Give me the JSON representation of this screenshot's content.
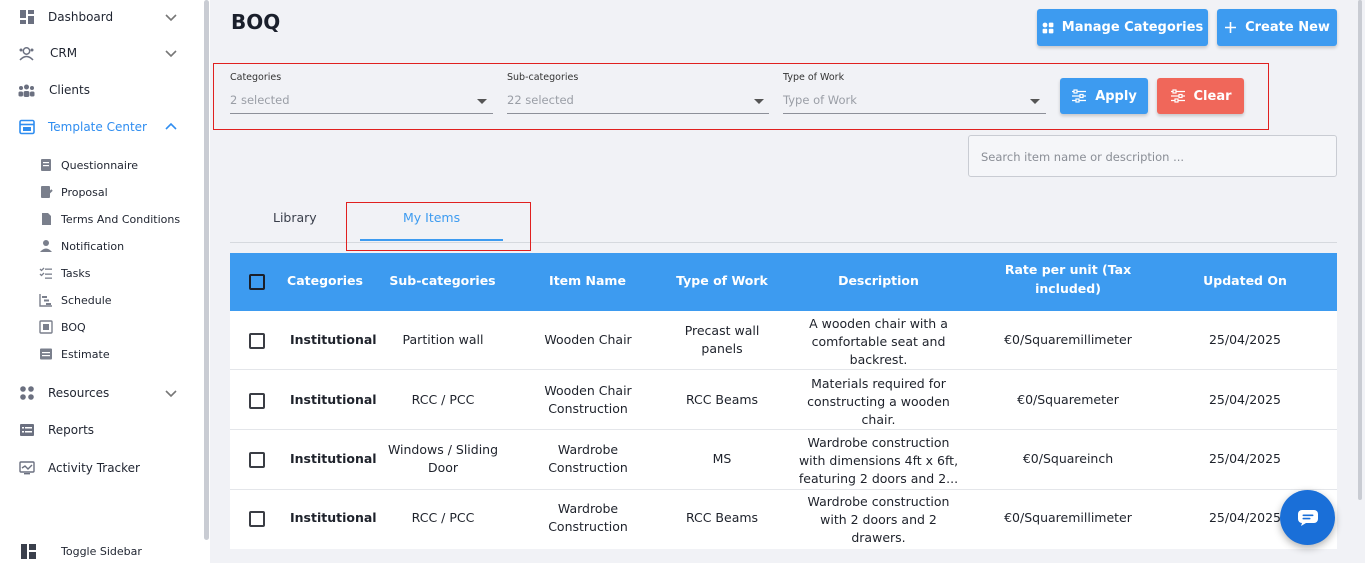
{
  "sidebar": {
    "items": [
      {
        "label": "Dashboard",
        "icon": "dashboard-icon",
        "has_chevron": true
      },
      {
        "label": "CRM",
        "icon": "crm-icon",
        "has_chevron": true
      },
      {
        "label": "Clients",
        "icon": "clients-icon",
        "has_chevron": false
      },
      {
        "label": "Template Center",
        "icon": "template-center-icon",
        "has_chevron": true,
        "active": true
      }
    ],
    "template_center_sub": [
      {
        "label": "Questionnaire",
        "icon": "questionnaire-icon"
      },
      {
        "label": "Proposal",
        "icon": "proposal-icon"
      },
      {
        "label": "Terms And Conditions",
        "icon": "document-icon"
      },
      {
        "label": "Notification",
        "icon": "person-icon"
      },
      {
        "label": "Tasks",
        "icon": "tasks-icon"
      },
      {
        "label": "Schedule",
        "icon": "schedule-icon"
      },
      {
        "label": "BOQ",
        "icon": "boq-icon"
      },
      {
        "label": "Estimate",
        "icon": "estimate-icon"
      }
    ],
    "bottom_items": [
      {
        "label": "Resources",
        "icon": "resources-icon",
        "has_chevron": true
      },
      {
        "label": "Reports",
        "icon": "reports-icon",
        "has_chevron": false
      },
      {
        "label": "Activity Tracker",
        "icon": "activity-icon",
        "has_chevron": false
      }
    ],
    "toggle_label": "Toggle Sidebar"
  },
  "header": {
    "title": "BOQ",
    "manage_categories_label": "Manage Categories",
    "create_new_label": "Create New"
  },
  "filters": {
    "categories_label": "Categories",
    "categories_value": "2 selected",
    "subcategories_label": "Sub-categories",
    "subcategories_value": "22 selected",
    "type_of_work_label": "Type of Work",
    "type_of_work_placeholder": "Type of Work",
    "apply_label": "Apply",
    "clear_label": "Clear"
  },
  "search": {
    "placeholder": "Search item name or description ..."
  },
  "tabs": {
    "library": "Library",
    "my_items": "My Items",
    "active": "my_items"
  },
  "table": {
    "headers": {
      "categories": "Categories",
      "subcategories": "Sub-categories",
      "item_name": "Item Name",
      "type_of_work": "Type of Work",
      "description": "Description",
      "rate_line1": "Rate per unit (Tax",
      "rate_line2": "included)",
      "updated_on": "Updated On"
    },
    "rows": [
      {
        "category": "Institutional",
        "subcategory_1": "Partition wall",
        "subcategory_2": "",
        "item_1": "Wooden Chair",
        "item_2": "",
        "work_1": "Precast wall",
        "work_2": "panels",
        "desc_1": "A wooden chair with a",
        "desc_2": "comfortable seat and",
        "desc_3": "backrest.",
        "rate": "€0/Squaremillimeter",
        "updated": "25/04/2025"
      },
      {
        "category": "Institutional",
        "subcategory_1": "RCC / PCC",
        "subcategory_2": "",
        "item_1": "Wooden Chair",
        "item_2": "Construction",
        "work_1": "RCC Beams",
        "work_2": "",
        "desc_1": "Materials required for",
        "desc_2": "constructing a wooden",
        "desc_3": "chair.",
        "rate": "€0/Squaremeter",
        "updated": "25/04/2025"
      },
      {
        "category": "Institutional",
        "subcategory_1": "Windows / Sliding",
        "subcategory_2": "Door",
        "item_1": "Wardrobe",
        "item_2": "Construction",
        "work_1": "MS",
        "work_2": "",
        "desc_1": "Wardrobe construction",
        "desc_2": "with dimensions 4ft x 6ft,",
        "desc_3": "featuring 2 doors and 2...",
        "rate": "€0/Squareinch",
        "updated": "25/04/2025"
      },
      {
        "category": "Institutional",
        "subcategory_1": "RCC / PCC",
        "subcategory_2": "",
        "item_1": "Wardrobe",
        "item_2": "Construction",
        "work_1": "RCC Beams",
        "work_2": "",
        "desc_1": "Wardrobe construction",
        "desc_2": "with 2 doors and 2",
        "desc_3": "drawers.",
        "rate": "€0/Squaremillimeter",
        "updated": "25/04/2025"
      }
    ]
  },
  "colors": {
    "accent": "#3d9bf0",
    "danger": "#f0675a",
    "highlight_border": "#e0201f",
    "chat_button": "#1a6fd8"
  }
}
